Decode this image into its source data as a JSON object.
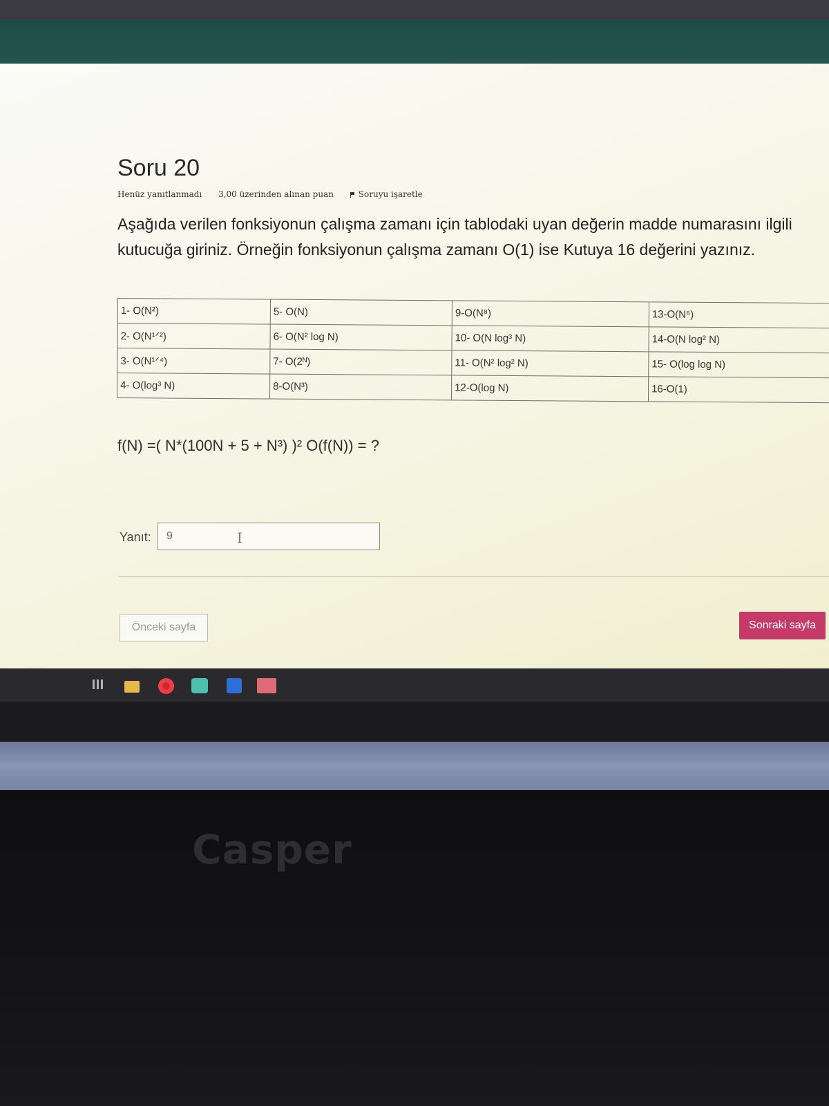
{
  "question": {
    "title": "Soru 20",
    "status": "Henüz yanıtlanmadı",
    "points": "3,00 üzerinden alınan puan",
    "flag_label": "Soruyu işaretle",
    "text": "Aşağıda verilen fonksiyonun çalışma zamanı için tablodaki uyan değerin madde numarasını ilgili kutucuğa giriniz. Örneğin fonksiyonun çalışma zamanı O(1) ise Kutuya 16 değerini yazınız.",
    "options_table": [
      [
        "1- O(N²)",
        "5- O(N)",
        "9-O(N⁸)",
        "13-O(N⁶)"
      ],
      [
        "2- O(N¹ᐟ²)",
        "6- O(N² log N)",
        "10- O(N log³ N)",
        "14-O(N log² N)"
      ],
      [
        "3- O(N¹ᐟ⁴)",
        "7- O(2ᴺ)",
        "11- O(N² log² N)",
        "15- O(log log N)"
      ],
      [
        "4- O(log³ N)",
        "8-O(N³)",
        "12-O(log N)",
        "16-O(1)"
      ]
    ],
    "formula": "f(N) =( N*(100N + 5 + N³) )²   O(f(N)) = ?"
  },
  "answer": {
    "label": "Yanıt:",
    "value": "9"
  },
  "navigation": {
    "prev_label": "Önceki sayfa",
    "next_label": "Sonraki sayfa"
  },
  "taskbar": {
    "icons": [
      "task-view-icon",
      "file-explorer-icon",
      "opera-browser-icon",
      "app-icon",
      "app-icon",
      "app-icon"
    ]
  },
  "hardware": {
    "brand": "Casper"
  },
  "colors": {
    "accent": "#c63a6a",
    "header_teal": "#23524c"
  }
}
